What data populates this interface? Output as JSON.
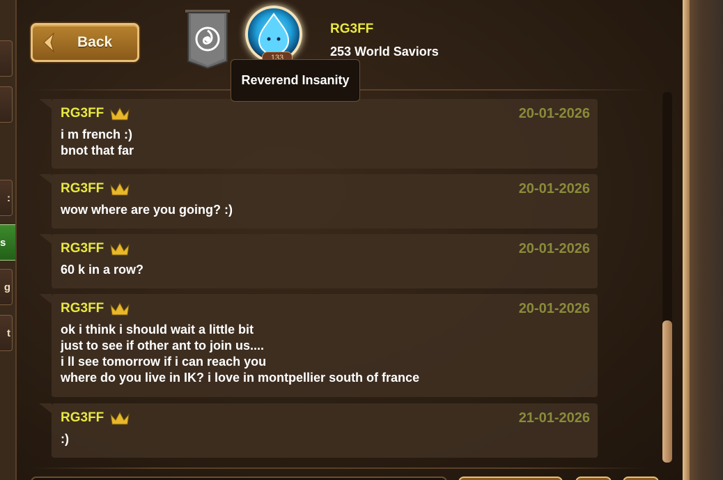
{
  "header": {
    "back_label": "Back",
    "player_name": "RG3FF",
    "player_subtitle": "253 World Saviors",
    "avatar_level": "133",
    "tooltip": "Reverend Insanity"
  },
  "side_tabs": [
    {
      "label": ""
    },
    {
      "label": ""
    },
    {
      "label": ":"
    },
    {
      "label": "s"
    },
    {
      "label": "g"
    },
    {
      "label": "t"
    }
  ],
  "messages": [
    {
      "author": "RG3FF",
      "date": "20-01-2026",
      "text": "i m french :)\nbnot that far"
    },
    {
      "author": "RG3FF",
      "date": "20-01-2026",
      "text": "wow where are you going? :)"
    },
    {
      "author": "RG3FF",
      "date": "20-01-2026",
      "text": "60 k in a row?"
    },
    {
      "author": "RG3FF",
      "date": "20-01-2026",
      "text": "ok i think i should wait a little bit\njust to see if other ant to join us....\ni ll see tomorrow if i can reach you\nwhere do you live in IK? i love in montpellier south of france"
    },
    {
      "author": "RG3FF",
      "date": "21-01-2026",
      "text": ":)"
    }
  ],
  "colors": {
    "author": "#e8e840",
    "date": "#8a8a3a",
    "active_tab": "#3d8a2c"
  },
  "icons": [
    "crown-icon",
    "back-arrow-icon",
    "guild-banner-icon"
  ]
}
